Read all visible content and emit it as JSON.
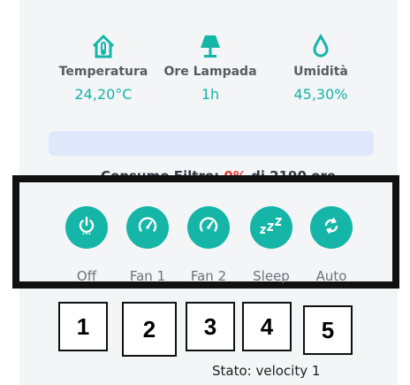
{
  "stats": [
    {
      "label": "Temperatura",
      "value": "24,20°C",
      "icon": "house-thermometer-icon"
    },
    {
      "label": "Ore Lampada",
      "value": "1h",
      "icon": "lamp-icon"
    },
    {
      "label": "Umidità",
      "value": "45,30%",
      "icon": "water-drop-icon"
    }
  ],
  "filter": {
    "prefix": "Consumo Filtro: ",
    "percent": "0%",
    "suffix": " di 2190 ore"
  },
  "modes": [
    {
      "label": "Off",
      "icon": "power-icon"
    },
    {
      "label": "Fan 1",
      "icon": "gauge-icon"
    },
    {
      "label": "Fan 2",
      "icon": "gauge-icon"
    },
    {
      "label": "Sleep",
      "icon": "sleep-zzz-icon"
    },
    {
      "label": "Auto",
      "icon": "refresh-icon"
    }
  ],
  "annotations": [
    "1",
    "2",
    "3",
    "4",
    "5"
  ],
  "status": "Stato: velocity 1",
  "colors": {
    "accent": "#15b5a8",
    "filter_bar": "#dfe8fb",
    "frame": "#111111",
    "percent": "#e53935"
  }
}
